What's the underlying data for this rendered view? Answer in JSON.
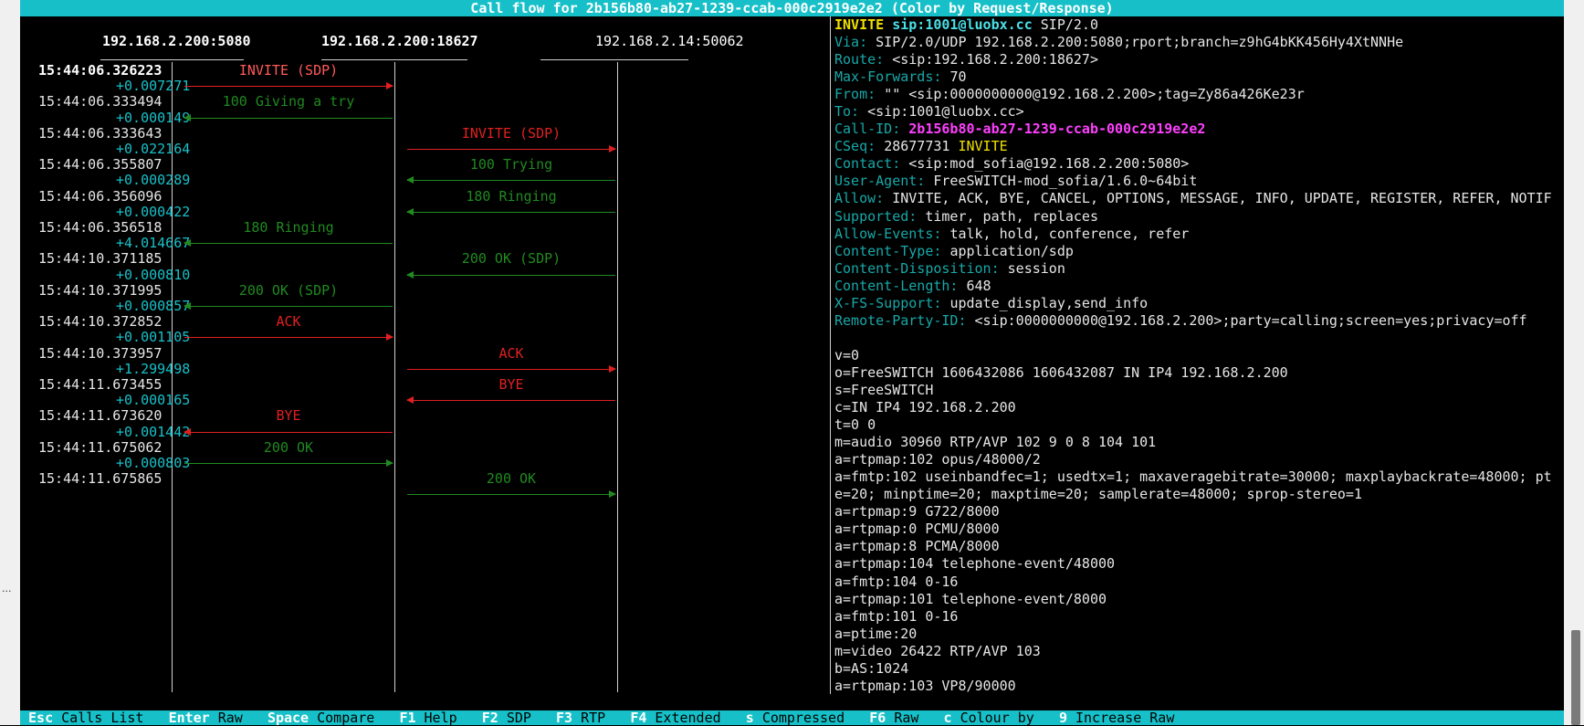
{
  "window": {
    "title": "Call flow for 2b156b80-ab27-1239-ccab-000c2919e2e2 (Color by Request/Response)"
  },
  "left_strip_marks": [
    "..."
  ],
  "colors": {
    "title_bg": "#17c0c8",
    "request": "#e02020",
    "response": "#208a20",
    "delta": "#18c0c8",
    "header_key": "#18a8a8",
    "call_id": "#ff40ff",
    "method": "#f0e000"
  },
  "hosts": [
    {
      "label": "192.168.2.200:5080",
      "bold": true
    },
    {
      "label": "192.168.2.200:18627",
      "bold": true
    },
    {
      "label": "192.168.2.14:50062",
      "bold": false
    }
  ],
  "rows": [
    {
      "time": "15:44:06.326223",
      "delta": "+0.007271",
      "label": "INVITE (SDP)",
      "kind": "request",
      "from": 0,
      "to": 1,
      "selected": true
    },
    {
      "time": "15:44:06.333494",
      "delta": "+0.000149",
      "label": "100 Giving a try",
      "kind": "response",
      "from": 1,
      "to": 0
    },
    {
      "time": "15:44:06.333643",
      "delta": "+0.022164",
      "label": "INVITE (SDP)",
      "kind": "request",
      "from": 1,
      "to": 2
    },
    {
      "time": "15:44:06.355807",
      "delta": "+0.000289",
      "label": "100 Trying",
      "kind": "response",
      "from": 2,
      "to": 1
    },
    {
      "time": "15:44:06.356096",
      "delta": "+0.000422",
      "label": "180 Ringing",
      "kind": "response",
      "from": 2,
      "to": 1
    },
    {
      "time": "15:44:06.356518",
      "delta": "+4.014667",
      "label": "180 Ringing",
      "kind": "response",
      "from": 1,
      "to": 0
    },
    {
      "time": "15:44:10.371185",
      "delta": "+0.000810",
      "label": "200 OK (SDP)",
      "kind": "response",
      "from": 2,
      "to": 1
    },
    {
      "time": "15:44:10.371995",
      "delta": "+0.000857",
      "label": "200 OK (SDP)",
      "kind": "response",
      "from": 1,
      "to": 0
    },
    {
      "time": "15:44:10.372852",
      "delta": "+0.001105",
      "label": "ACK",
      "kind": "request",
      "from": 0,
      "to": 1
    },
    {
      "time": "15:44:10.373957",
      "delta": "+1.299498",
      "label": "ACK",
      "kind": "request",
      "from": 1,
      "to": 2
    },
    {
      "time": "15:44:11.673455",
      "delta": "+0.000165",
      "label": "BYE",
      "kind": "request",
      "from": 2,
      "to": 1
    },
    {
      "time": "15:44:11.673620",
      "delta": "+0.001442",
      "label": "BYE",
      "kind": "request",
      "from": 1,
      "to": 0
    },
    {
      "time": "15:44:11.675062",
      "delta": "+0.000803",
      "label": "200 OK",
      "kind": "response",
      "from": 0,
      "to": 1
    },
    {
      "time": "15:44:11.675865",
      "delta": "",
      "label": "200 OK",
      "kind": "response",
      "from": 1,
      "to": 2
    }
  ],
  "raw_message": {
    "request_line": {
      "method": "INVITE",
      "uri": "sip:1001@luobx.cc",
      "version": "SIP/2.0"
    },
    "headers": [
      {
        "key": "Via:",
        "value": "SIP/2.0/UDP 192.168.2.200:5080;rport;branch=z9hG4bKK456Hy4XtNNHe"
      },
      {
        "key": "Route:",
        "value": "<sip:192.168.2.200:18627>"
      },
      {
        "key": "Max-Forwards:",
        "value": "70"
      },
      {
        "key": "From:",
        "value": "\"\" <sip:0000000000@192.168.2.200>;tag=Zy86a426Ke23r"
      },
      {
        "key": "To:",
        "value": "<sip:1001@luobx.cc>"
      },
      {
        "key": "Call-ID:",
        "value": "2b156b80-ab27-1239-ccab-000c2919e2e2",
        "style": "magenta"
      },
      {
        "key": "CSeq:",
        "value": "28677731",
        "extra": "INVITE"
      },
      {
        "key": "Contact:",
        "value": "<sip:mod_sofia@192.168.2.200:5080>"
      },
      {
        "key": "User-Agent:",
        "value": "FreeSWITCH-mod_sofia/1.6.0~64bit"
      },
      {
        "key": "Allow:",
        "value": "INVITE, ACK, BYE, CANCEL, OPTIONS, MESSAGE, INFO, UPDATE, REGISTER, REFER, NOTIF"
      },
      {
        "key": "Supported:",
        "value": "timer, path, replaces"
      },
      {
        "key": "Allow-Events:",
        "value": "talk, hold, conference, refer"
      },
      {
        "key": "Content-Type:",
        "value": "application/sdp"
      },
      {
        "key": "Content-Disposition:",
        "value": "session"
      },
      {
        "key": "Content-Length:",
        "value": "648"
      },
      {
        "key": "X-FS-Support:",
        "value": "update_display,send_info"
      },
      {
        "key": "Remote-Party-ID:",
        "value": "<sip:0000000000@192.168.2.200>;party=calling;screen=yes;privacy=off"
      }
    ],
    "body": [
      "",
      "v=0",
      "o=FreeSWITCH 1606432086 1606432087 IN IP4 192.168.2.200",
      "s=FreeSWITCH",
      "c=IN IP4 192.168.2.200",
      "t=0 0",
      "m=audio 30960 RTP/AVP 102 9 0 8 104 101",
      "a=rtpmap:102 opus/48000/2",
      "a=fmtp:102 useinbandfec=1; usedtx=1; maxaveragebitrate=30000; maxplaybackrate=48000; pt",
      "e=20; minptime=20; maxptime=20; samplerate=48000; sprop-stereo=1",
      "a=rtpmap:9 G722/8000",
      "a=rtpmap:0 PCMU/8000",
      "a=rtpmap:8 PCMA/8000",
      "a=rtpmap:104 telephone-event/48000",
      "a=fmtp:104 0-16",
      "a=rtpmap:101 telephone-event/8000",
      "a=fmtp:101 0-16",
      "a=ptime:20",
      "m=video 26422 RTP/AVP 103",
      "b=AS:1024",
      "a=rtpmap:103 VP8/90000"
    ]
  },
  "shortcuts": [
    {
      "key": "Esc",
      "action": "Calls List"
    },
    {
      "key": "Enter",
      "action": "Raw"
    },
    {
      "key": "Space",
      "action": "Compare"
    },
    {
      "key": "F1",
      "action": "Help"
    },
    {
      "key": "F2",
      "action": "SDP"
    },
    {
      "key": "F3",
      "action": "RTP"
    },
    {
      "key": "F4",
      "action": "Extended"
    },
    {
      "key": "s",
      "action": "Compressed"
    },
    {
      "key": "F6",
      "action": "Raw"
    },
    {
      "key": "c",
      "action": "Colour by"
    },
    {
      "key": "9",
      "action": "Increase Raw"
    }
  ]
}
